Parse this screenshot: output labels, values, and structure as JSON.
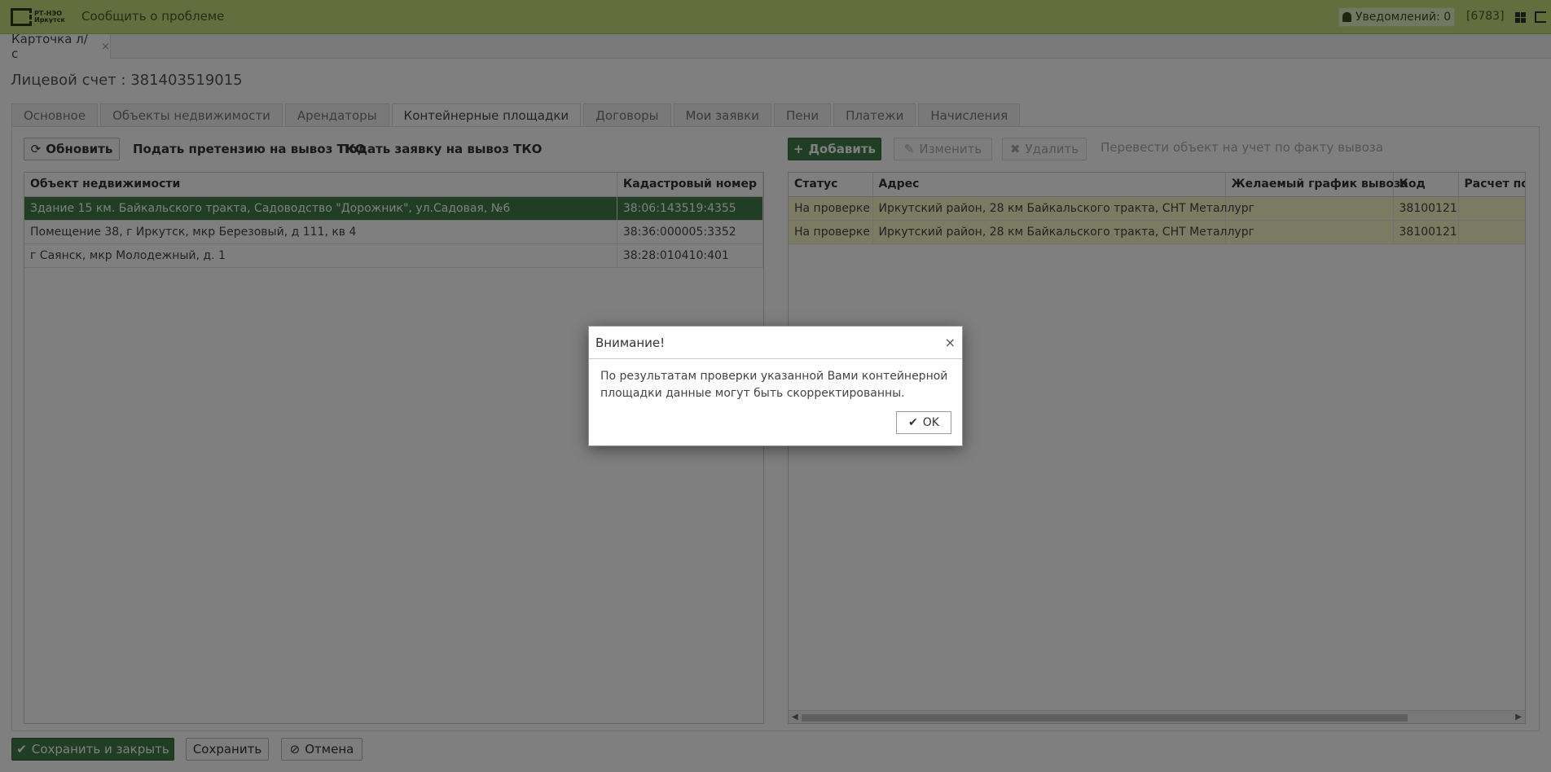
{
  "header": {
    "logo_text": "РТ-НЭО Иркутск",
    "report_link": "Сообщить о проблеме",
    "notifications": "Уведомлений: 0",
    "user_id": "[6783]"
  },
  "doc_tab": {
    "label": "Карточка л/с",
    "close": "×"
  },
  "account_title": "Лицевой счет : 381403519015",
  "tabs": [
    "Основное",
    "Объекты недвижимости",
    "Арендаторы",
    "Контейнерные площадки",
    "Договоры",
    "Мои заявки",
    "Пени",
    "Платежи",
    "Начисления"
  ],
  "active_tab_index": 3,
  "left": {
    "refresh_button": "Обновить",
    "claim_link": "Подать претензию на вывоз ТКО",
    "request_link": "Подать заявку на вывоз ТКО",
    "columns": [
      "Объект недвижимости",
      "Кадастровый номер"
    ],
    "rows": [
      [
        "Здание 15 км. Байкальского тракта, Садоводство \"Дорожник\", ул.Садовая, №6",
        "38:06:143519:4355"
      ],
      [
        "Помещение 38, г Иркутск, мкр Березовый, д 111, кв 4",
        "38:36:000005:3352"
      ],
      [
        "г Саянск, мкр Молодежный, д. 1",
        "38:28:010410:401"
      ]
    ],
    "selected_row": 0
  },
  "right": {
    "add_button": "Добавить",
    "edit_button": "Изменить",
    "delete_button": "Удалить",
    "transfer_link": "Перевести объект на учет по факту вывоза",
    "columns": [
      "Статус",
      "Адрес",
      "Желаемый график вывоза",
      "Код",
      "Расчет по ф"
    ],
    "rows": [
      [
        "На проверке",
        "Иркутский район, 28 км Байкальского тракта, СНТ Металлург",
        "",
        "38100121",
        ""
      ],
      [
        "На проверке",
        "Иркутский район, 28 км Байкальского тракта, СНТ Металлург",
        "",
        "38100121",
        ""
      ]
    ]
  },
  "footer": {
    "save_close": "Сохранить и закрыть",
    "save": "Сохранить",
    "cancel": "Отмена"
  },
  "modal": {
    "title": "Внимание!",
    "close": "×",
    "message": "По результатам проверки указанной Вами контейнерной площадки данные могут быть скорректированны.",
    "ok": "OK"
  },
  "colors": {
    "header_bg": "#c5dd7c",
    "accent_green": "#3e7d48",
    "row_highlight": "#f5f7c4"
  }
}
